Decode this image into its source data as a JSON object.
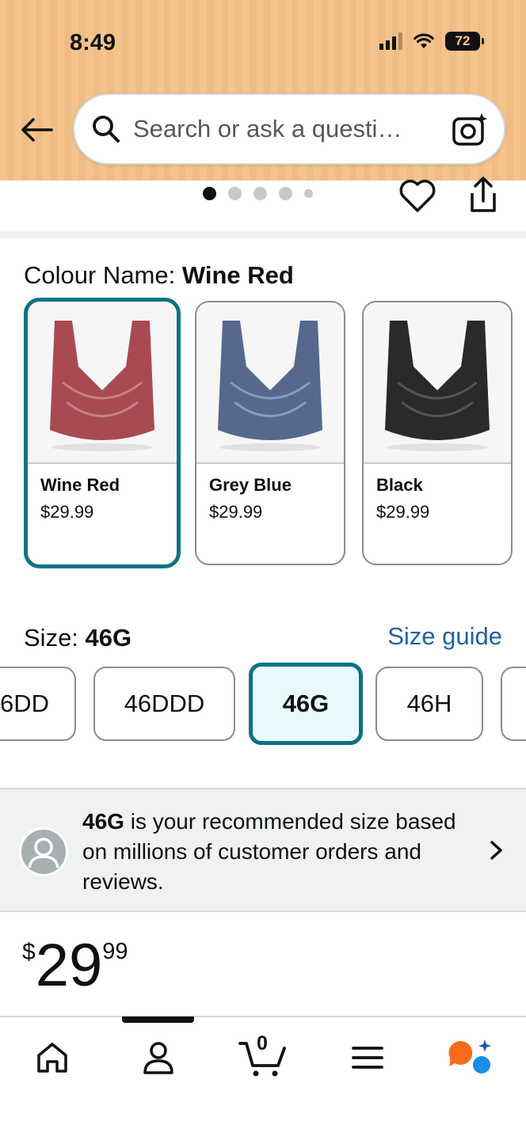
{
  "status_bar": {
    "time": "8:49",
    "battery": "72"
  },
  "search": {
    "placeholder": "Search or ask a questi…"
  },
  "carousel": {
    "total_images": 5,
    "active_index": 0
  },
  "colour": {
    "label": "Colour Name: ",
    "selected": "Wine Red",
    "options": [
      {
        "name": "Wine Red",
        "price": "$29.99",
        "color": "#a94a52",
        "selected": true
      },
      {
        "name": "Grey Blue",
        "price": "$29.99",
        "color": "#56688e",
        "selected": false
      },
      {
        "name": "Black",
        "price": "$29.99",
        "color": "#2a2a2c",
        "selected": false
      }
    ]
  },
  "size": {
    "label": "Size: ",
    "selected": "46G",
    "guide_label": "Size guide",
    "options": [
      "6DD",
      "46DDD",
      "46G",
      "46H",
      ""
    ]
  },
  "recommendation": {
    "size": "46G",
    "text": " is your recommended size based on millions of customer orders and reviews."
  },
  "price": {
    "symbol": "$",
    "whole": "29",
    "fraction": "99"
  },
  "bottom_nav": {
    "items": [
      "home-icon",
      "account-icon",
      "cart-icon",
      "menu-icon",
      "rufus-icon"
    ],
    "cart_count": "0",
    "active_index": 1
  },
  "colors": {
    "accent": "#0b7285",
    "link": "#2162a1",
    "header": "#f3c48e"
  }
}
